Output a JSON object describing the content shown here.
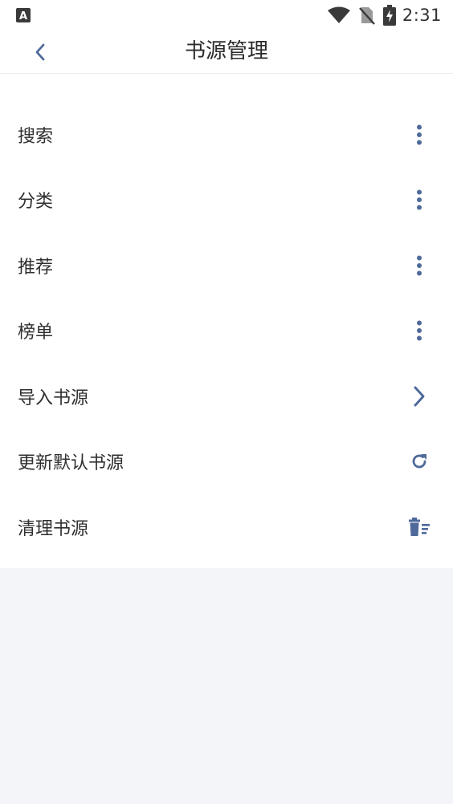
{
  "status_bar": {
    "time": "2:31",
    "app_icon_letter": "A"
  },
  "header": {
    "title": "书源管理",
    "back_icon": "chevron-left-icon"
  },
  "menu": {
    "items": [
      {
        "label": "搜索",
        "icon": "more-vertical-icon"
      },
      {
        "label": "分类",
        "icon": "more-vertical-icon"
      },
      {
        "label": "推荐",
        "icon": "more-vertical-icon"
      },
      {
        "label": "榜单",
        "icon": "more-vertical-icon"
      },
      {
        "label": "导入书源",
        "icon": "chevron-right-icon"
      },
      {
        "label": "更新默认书源",
        "icon": "refresh-icon"
      },
      {
        "label": "清理书源",
        "icon": "trash-clear-icon"
      }
    ]
  },
  "colors": {
    "accent": "#4f6a9a",
    "page_background": "#f4f5f9",
    "surface": "#ffffff",
    "text": "#2f2f2f"
  }
}
